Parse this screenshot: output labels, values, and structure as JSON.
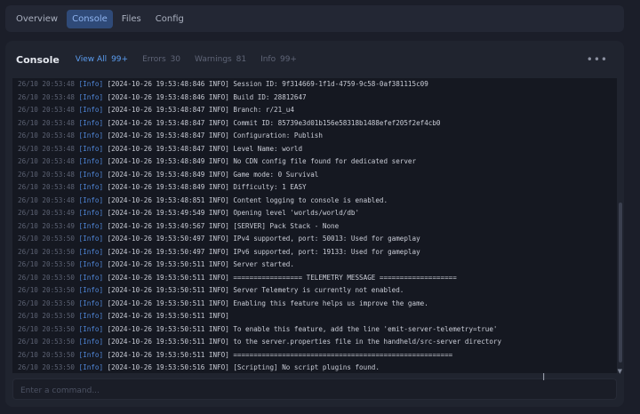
{
  "nav": {
    "tabs": [
      {
        "label": "Overview"
      },
      {
        "label": "Console"
      },
      {
        "label": "Files"
      },
      {
        "label": "Config"
      }
    ]
  },
  "console": {
    "title": "Console",
    "filters": [
      {
        "label": "View All",
        "count": "99+"
      },
      {
        "label": "Errors",
        "count": "30"
      },
      {
        "label": "Warnings",
        "count": "81"
      },
      {
        "label": "Info",
        "count": "99+"
      }
    ],
    "more_icon": "more-horizontal-icon",
    "lines": [
      {
        "time": "26/10 20:53:48",
        "level": "[Info]",
        "message": "[2024-10-26 19:53:48:846 INFO] Session ID: 9f314669-1f1d-4759-9c58-0af381115c09"
      },
      {
        "time": "26/10 20:53:48",
        "level": "[Info]",
        "message": "[2024-10-26 19:53:48:846 INFO] Build ID: 28812647"
      },
      {
        "time": "26/10 20:53:48",
        "level": "[Info]",
        "message": "[2024-10-26 19:53:48:847 INFO] Branch: r/21_u4"
      },
      {
        "time": "26/10 20:53:48",
        "level": "[Info]",
        "message": "[2024-10-26 19:53:48:847 INFO] Commit ID: 85739e3d01b156e58318b1488efef205f2ef4cb0"
      },
      {
        "time": "26/10 20:53:48",
        "level": "[Info]",
        "message": "[2024-10-26 19:53:48:847 INFO] Configuration: Publish"
      },
      {
        "time": "26/10 20:53:48",
        "level": "[Info]",
        "message": "[2024-10-26 19:53:48:847 INFO] Level Name: world"
      },
      {
        "time": "26/10 20:53:48",
        "level": "[Info]",
        "message": "[2024-10-26 19:53:48:849 INFO] No CDN config file found for dedicated server"
      },
      {
        "time": "26/10 20:53:48",
        "level": "[Info]",
        "message": "[2024-10-26 19:53:48:849 INFO] Game mode: 0 Survival"
      },
      {
        "time": "26/10 20:53:48",
        "level": "[Info]",
        "message": "[2024-10-26 19:53:48:849 INFO] Difficulty: 1 EASY"
      },
      {
        "time": "26/10 20:53:48",
        "level": "[Info]",
        "message": "[2024-10-26 19:53:48:851 INFO] Content logging to console is enabled."
      },
      {
        "time": "26/10 20:53:49",
        "level": "[Info]",
        "message": "[2024-10-26 19:53:49:549 INFO] Opening level 'worlds/world/db'"
      },
      {
        "time": "26/10 20:53:49",
        "level": "[Info]",
        "message": "[2024-10-26 19:53:49:567 INFO] [SERVER] Pack Stack - None"
      },
      {
        "time": "26/10 20:53:50",
        "level": "[Info]",
        "message": "[2024-10-26 19:53:50:497 INFO] IPv4 supported, port: 50013: Used for gameplay"
      },
      {
        "time": "26/10 20:53:50",
        "level": "[Info]",
        "message": "[2024-10-26 19:53:50:497 INFO] IPv6 supported, port: 19133: Used for gameplay"
      },
      {
        "time": "26/10 20:53:50",
        "level": "[Info]",
        "message": "[2024-10-26 19:53:50:511 INFO] Server started."
      },
      {
        "time": "26/10 20:53:50",
        "level": "[Info]",
        "message": "[2024-10-26 19:53:50:511 INFO] ================= TELEMETRY MESSAGE ==================="
      },
      {
        "time": "26/10 20:53:50",
        "level": "[Info]",
        "message": "[2024-10-26 19:53:50:511 INFO] Server Telemetry is currently not enabled."
      },
      {
        "time": "26/10 20:53:50",
        "level": "[Info]",
        "message": "[2024-10-26 19:53:50:511 INFO] Enabling this feature helps us improve the game."
      },
      {
        "time": "26/10 20:53:50",
        "level": "[Info]",
        "message": "[2024-10-26 19:53:50:511 INFO]"
      },
      {
        "time": "26/10 20:53:50",
        "level": "[Info]",
        "message": "[2024-10-26 19:53:50:511 INFO] To enable this feature, add the line 'emit-server-telemetry=true'"
      },
      {
        "time": "26/10 20:53:50",
        "level": "[Info]",
        "message": "[2024-10-26 19:53:50:511 INFO] to the server.properties file in the handheld/src-server directory"
      },
      {
        "time": "26/10 20:53:50",
        "level": "[Info]",
        "message": "[2024-10-26 19:53:50:511 INFO] ======================================================"
      },
      {
        "time": "26/10 20:53:50",
        "level": "[Info]",
        "message": "[2024-10-26 19:53:50:516 INFO] [Scripting] No script plugins found."
      }
    ],
    "command_placeholder": "Enter a command..."
  }
}
